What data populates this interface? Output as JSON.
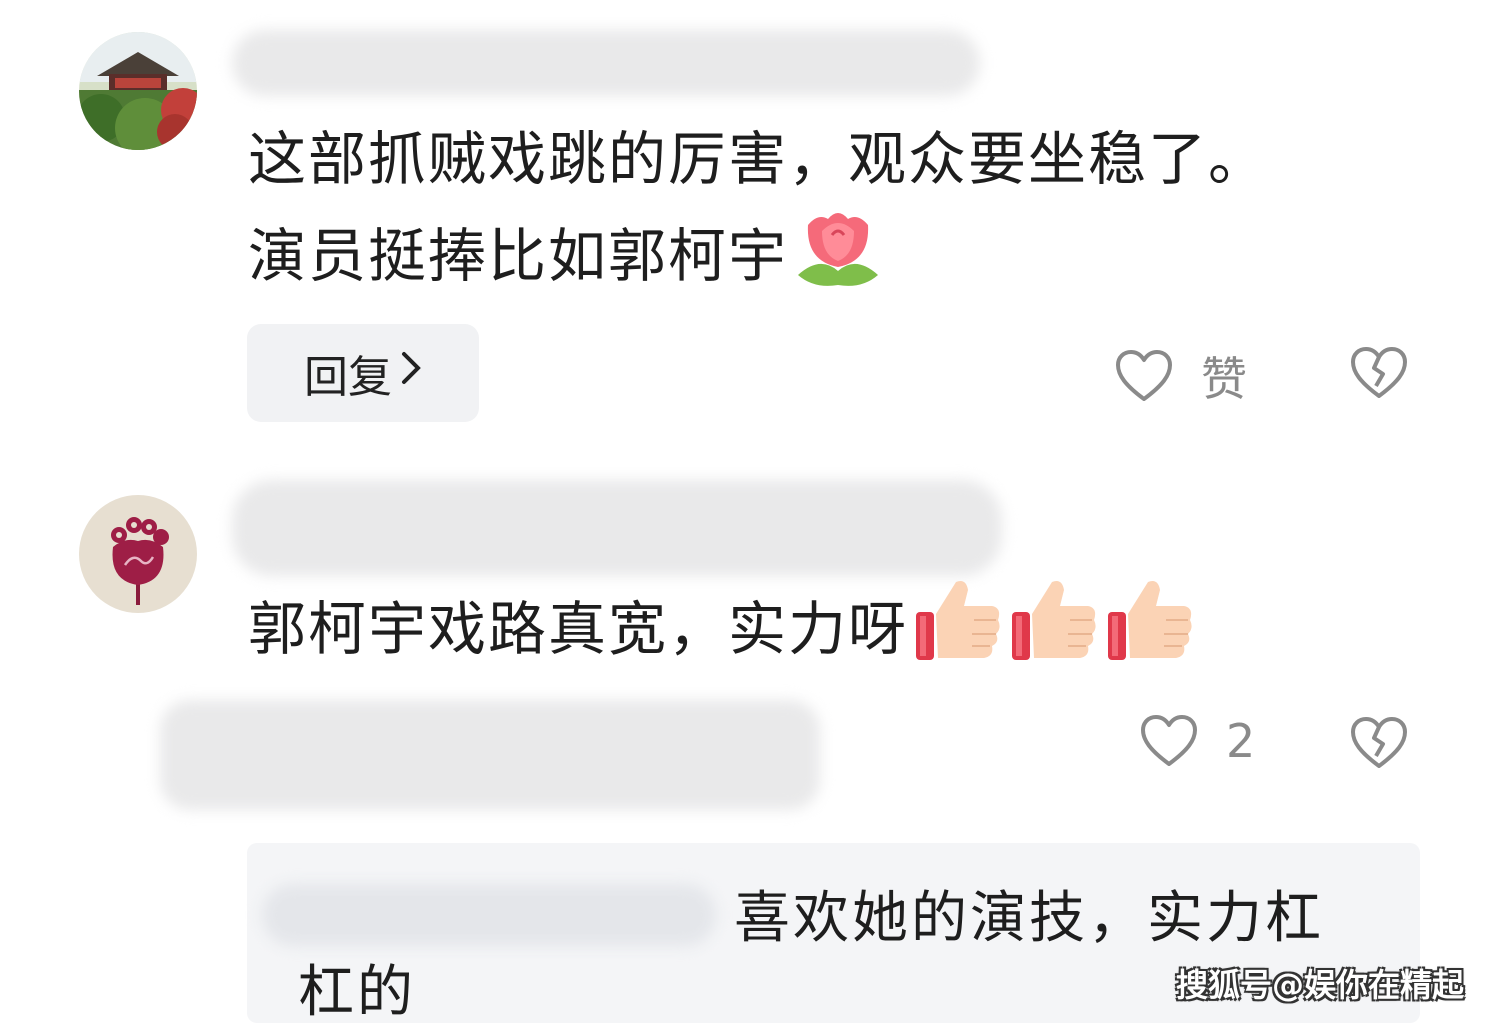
{
  "comments": [
    {
      "text_line1": "这部抓贼戏跳的厉害，观众要坐稳了。",
      "text_line2": "演员挺捧比如郭柯宇",
      "emoji": "tulip-icon",
      "reply_label": "回复",
      "reply_icon": "chevron-right-icon",
      "like_label": "赞",
      "like_icon": "heart-outline-icon",
      "dislike_icon": "broken-heart-icon"
    },
    {
      "text": "郭柯宇戏路真宽，实力呀",
      "emoji": [
        "thumbs-up-icon",
        "thumbs-up-icon",
        "thumbs-up-icon"
      ],
      "like_count": "2",
      "like_icon": "heart-outline-icon",
      "dislike_icon": "broken-heart-icon"
    }
  ],
  "reply_preview": {
    "text_line1": "喜欢她的演技，实力杠",
    "text_line2": "杠的"
  },
  "watermark": "搜狐号@娱你在精起",
  "colors": {
    "background": "#ffffff",
    "text": "#1e1e1e",
    "action_gray": "#8a8a8a",
    "reply_button_bg": "#f1f2f4",
    "reply_box_bg": "#f4f5f7"
  }
}
